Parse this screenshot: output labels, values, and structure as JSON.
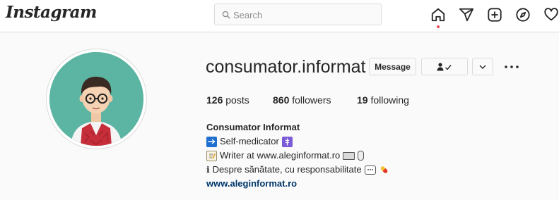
{
  "header": {
    "logo": "Instagram",
    "search_placeholder": "Search"
  },
  "profile": {
    "username": "consumator.informat",
    "message_label": "Message",
    "stats": {
      "posts_count": "126",
      "posts_label": "posts",
      "followers_count": "860",
      "followers_label": "followers",
      "following_count": "19",
      "following_label": "following"
    },
    "bio": {
      "full_name": "Consumator Informat",
      "line1": "Self-medicator",
      "line2": "Writer at www.aleginformat.ro",
      "line3": "Despre sănătate, cu responsabilitate",
      "line3_prefix": "ℹ",
      "website": "www.aleginformat.ro"
    }
  },
  "icons": {
    "nav": [
      "home-icon",
      "direct-icon",
      "new-post-icon",
      "explore-icon",
      "activity-icon"
    ],
    "emoji": [
      "arrow-right-emoji",
      "medical-emoji",
      "memo-emoji",
      "keyboard-emoji",
      "mouse-emoji",
      "speech-bubble-emoji",
      "pill-emoji"
    ]
  },
  "colors": {
    "accent_dot": "#ed4956",
    "link": "#00376b",
    "avatar_bg": "#5bb5a2"
  }
}
